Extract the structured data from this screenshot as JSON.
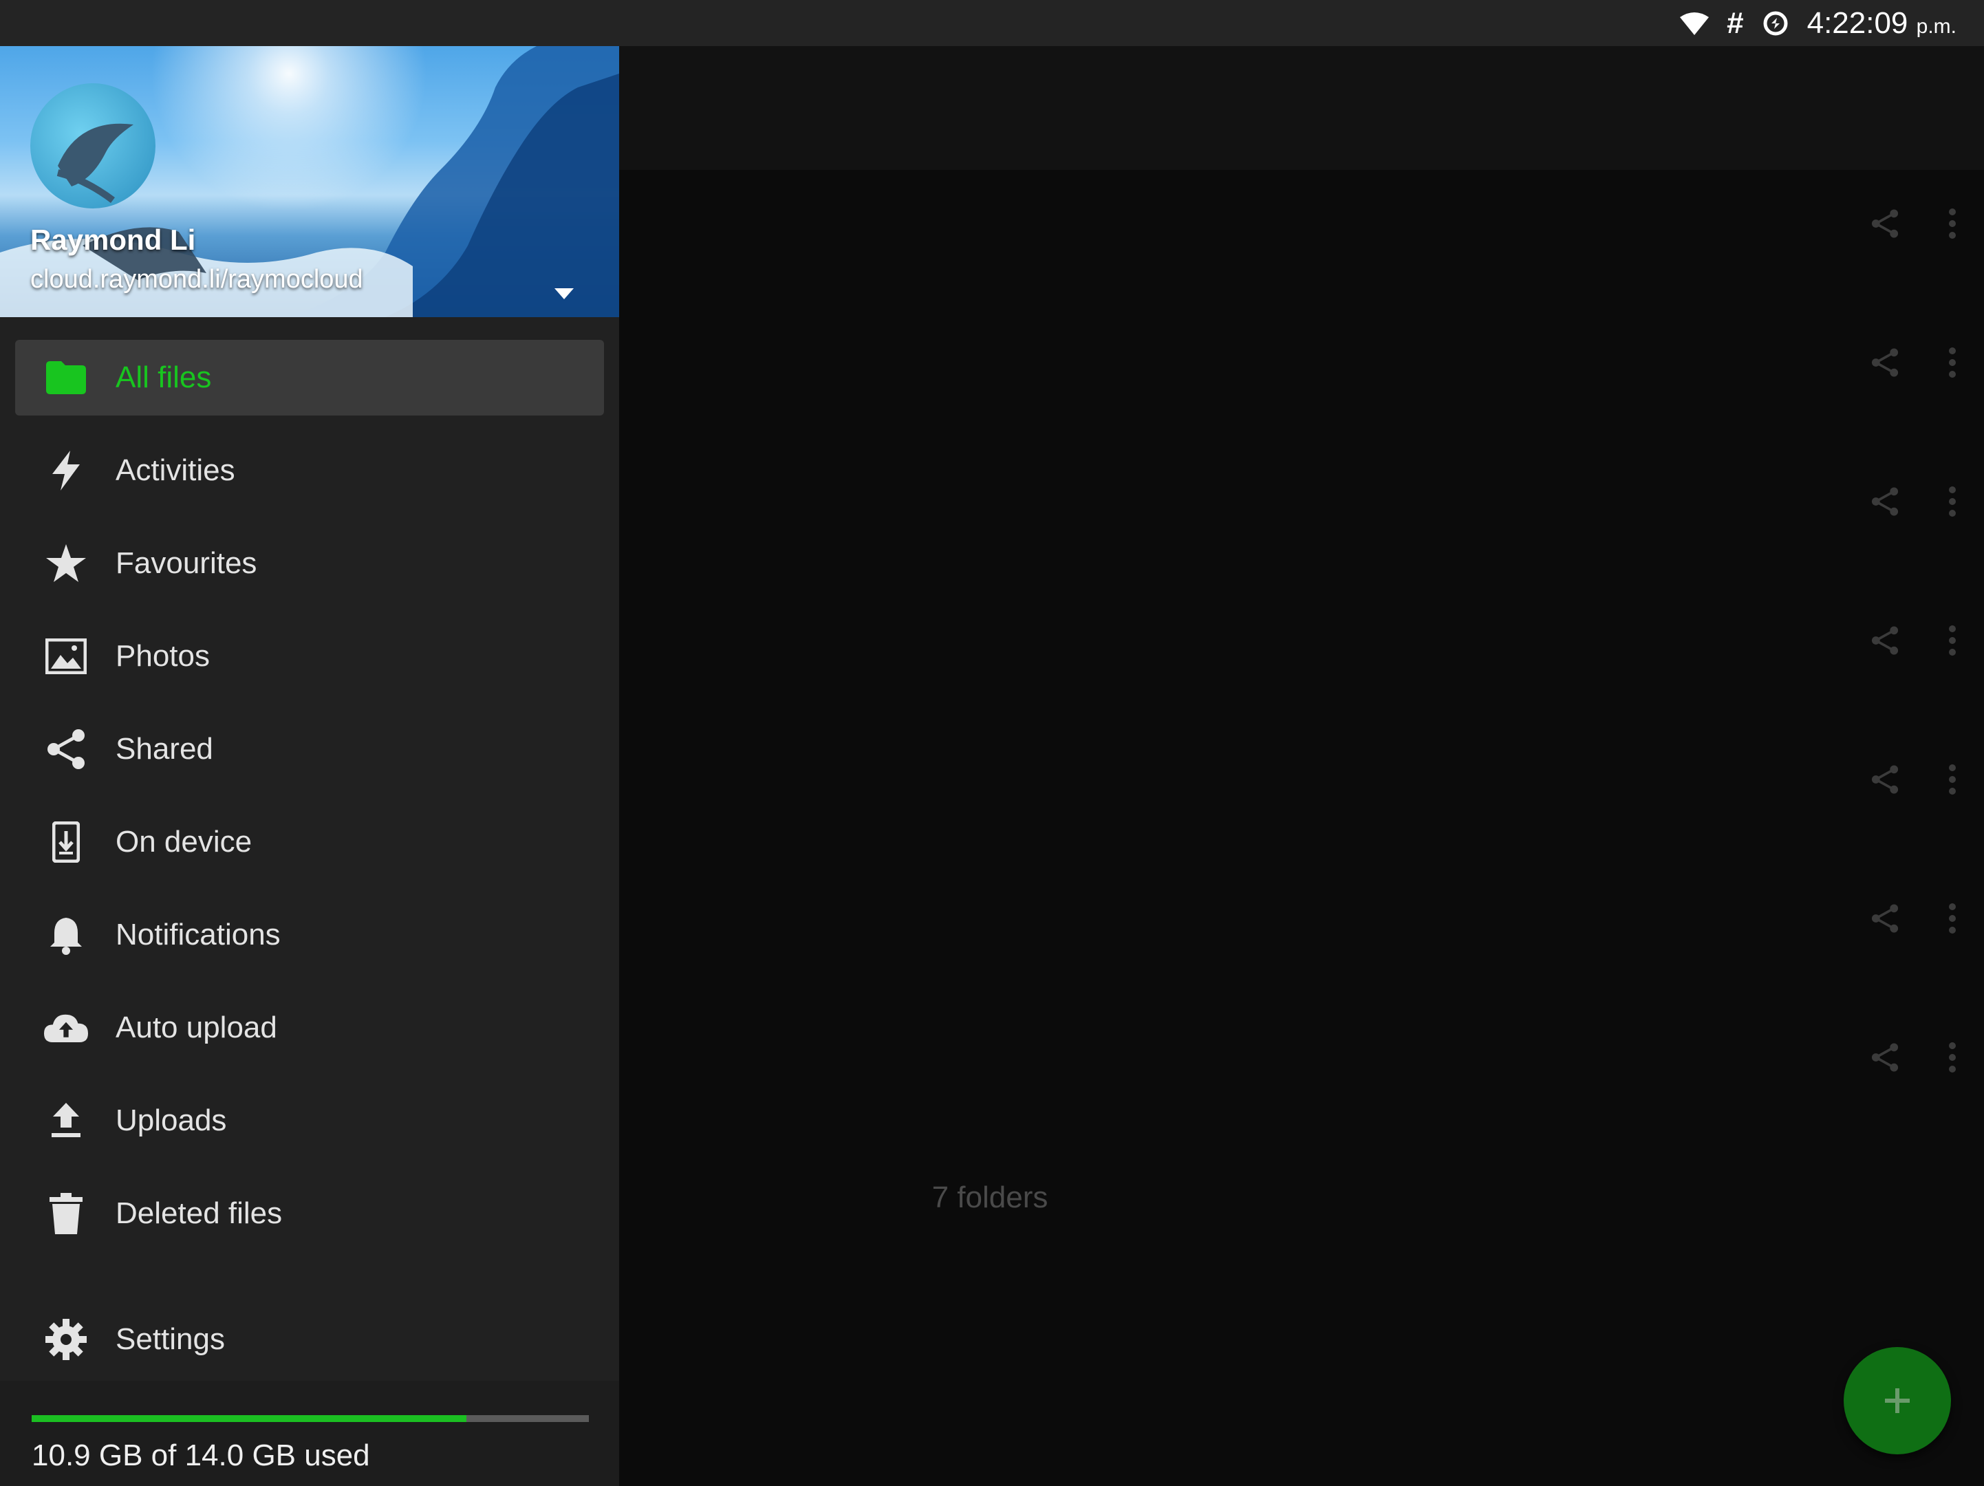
{
  "status_bar": {
    "time": "4:22:09",
    "meridiem": "p.m.",
    "hash_symbol": "#",
    "icons": [
      "wifi-icon",
      "hash-icon",
      "data-saver-icon"
    ]
  },
  "account": {
    "name": "Raymond Li",
    "server": "cloud.raymond.li/raymocloud"
  },
  "menu": {
    "items": [
      {
        "label": "All files",
        "icon": "folder-icon",
        "active": true
      },
      {
        "label": "Activities",
        "icon": "lightning-icon"
      },
      {
        "label": "Favourites",
        "icon": "star-icon"
      },
      {
        "label": "Photos",
        "icon": "image-icon"
      },
      {
        "label": "Shared",
        "icon": "share-icon"
      },
      {
        "label": "On device",
        "icon": "device-download-icon"
      },
      {
        "label": "Notifications",
        "icon": "bell-icon"
      },
      {
        "label": "Auto upload",
        "icon": "cloud-upload-icon"
      },
      {
        "label": "Uploads",
        "icon": "upload-icon"
      },
      {
        "label": "Deleted files",
        "icon": "trash-icon"
      },
      {
        "label": "Settings",
        "icon": "gear-icon"
      }
    ]
  },
  "storage": {
    "text": "10.9 GB of 14.0 GB used",
    "used_fraction": 0.78
  },
  "content": {
    "footer": "7 folders",
    "row_count": 7
  },
  "colors": {
    "accent": "#18c51f",
    "fab": "#0f6f14",
    "drawer_bg": "#212121"
  }
}
